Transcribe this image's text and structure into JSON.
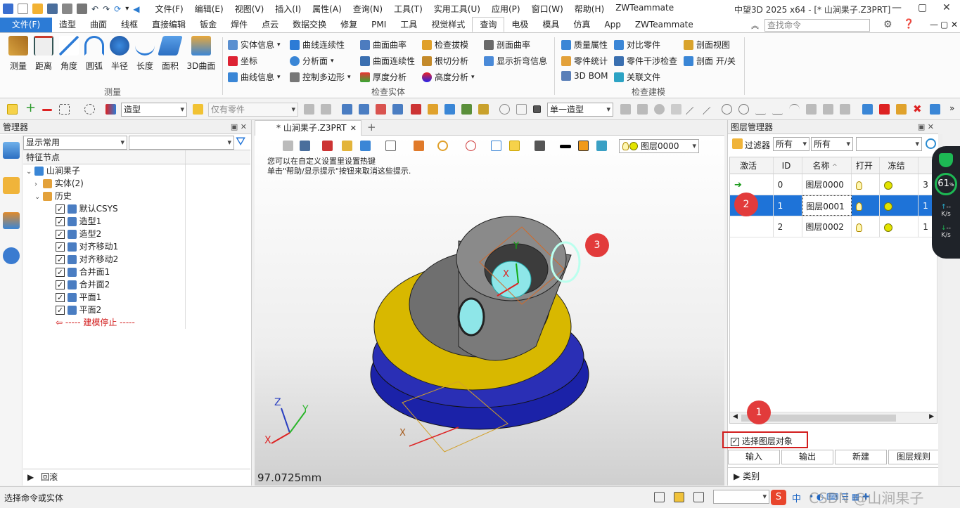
{
  "app": {
    "title": "中望3D 2025 x64 - [* 山涧果子.Z3PRT]"
  },
  "menu": [
    "文件(F)",
    "编辑(E)",
    "视图(V)",
    "插入(I)",
    "属性(A)",
    "查询(N)",
    "工具(T)",
    "实用工具(U)",
    "应用(P)",
    "窗口(W)",
    "帮助(H)",
    "ZWTeammate"
  ],
  "tabs": [
    "文件(F)",
    "造型",
    "曲面",
    "线框",
    "直接编辑",
    "钣金",
    "焊件",
    "点云",
    "数据交换",
    "修复",
    "PMI",
    "工具",
    "视觉样式",
    "查询",
    "电极",
    "模具",
    "仿真",
    "App",
    "ZWTeammate"
  ],
  "active_tab": "查询",
  "command_search": {
    "placeholder": "查找命令"
  },
  "ribbon": {
    "measure_group": "测量",
    "measure_buttons": [
      "测量",
      "距离",
      "角度",
      "圆弧",
      "半径",
      "长度",
      "面积",
      "3D曲面"
    ],
    "check_entity_group": "检查实体",
    "col1": [
      "实体信息",
      "坐标",
      "曲线信息"
    ],
    "col2": [
      "曲线连续性",
      "分析面",
      "控制多边形"
    ],
    "col3": [
      "曲面曲率",
      "曲面连续性",
      "厚度分析"
    ],
    "col4": [
      "检查拔模",
      "根切分析",
      "高度分析"
    ],
    "col5": [
      "剖面曲率",
      "显示折弯信息"
    ],
    "check_model_group": "检查建模",
    "col6": [
      "质量属性",
      "零件统计",
      "3D BOM"
    ],
    "col7": [
      "对比零件",
      "零件干涉检查",
      "关联文件"
    ],
    "col8": [
      "剖面视图",
      "剖面 开/关"
    ]
  },
  "toolbar": {
    "modeling_dd": "造型",
    "filter_dd": "仅有零件",
    "single_dd": "单一造型"
  },
  "manager": {
    "title": "管理器",
    "display_dd": "显示常用",
    "col_header": "特征节点",
    "tree": [
      {
        "label": "山涧果子",
        "level": 0,
        "check": false
      },
      {
        "label": "实体(2)",
        "level": 1,
        "check": false
      },
      {
        "label": "历史",
        "level": 1,
        "check": false
      },
      {
        "label": "默认CSYS",
        "level": 2,
        "check": true
      },
      {
        "label": "造型1",
        "level": 2,
        "check": true
      },
      {
        "label": "造型2",
        "level": 2,
        "check": true
      },
      {
        "label": "对齐移动1",
        "level": 2,
        "check": true
      },
      {
        "label": "对齐移动2",
        "level": 2,
        "check": true
      },
      {
        "label": "合并面1",
        "level": 2,
        "check": true
      },
      {
        "label": "合并面2",
        "level": 2,
        "check": true
      },
      {
        "label": "平面1",
        "level": 2,
        "check": true
      },
      {
        "label": "平面2",
        "level": 2,
        "check": true
      }
    ],
    "stop_label": "----- 建模停止 -----",
    "rollback": "回滚"
  },
  "viewport": {
    "doc_tab": "* 山涧果子.Z3PRT",
    "layer_dd": "图层0000",
    "hint1": "您可以在自定义设置里设置热键",
    "hint2": "单击\"帮助/显示提示\"按钮来取消这些提示.",
    "measure": "97.0725mm",
    "axis": {
      "x": "X",
      "y": "Y",
      "z": "Z"
    }
  },
  "layer_manager": {
    "title": "图层管理器",
    "filter_label": "过滤器",
    "filter1": "所有",
    "filter2": "所有",
    "headers": [
      "激活",
      "ID",
      "名称",
      "打开",
      "冻结"
    ],
    "rows": [
      {
        "id": "0",
        "name": "图层0000",
        "extra": "3"
      },
      {
        "id": "1",
        "name": "图层0001",
        "extra": "1"
      },
      {
        "id": "2",
        "name": "图层0002",
        "extra": "1"
      }
    ],
    "select_obj": "选择图层对象",
    "buttons": [
      "输入",
      "输出",
      "新建",
      "图层规则"
    ],
    "category": "类别"
  },
  "annotations": [
    "1",
    "2",
    "3"
  ],
  "widget": {
    "percent": "61",
    "pct_unit": "%",
    "speed": "K/s",
    "dash": "--"
  },
  "status": {
    "text": "选择命令或实体",
    "ime": "中",
    "watermark": "CSDN @山涧果子"
  },
  "colors": {
    "accent": "#2c7bd6",
    "select": "#1e73d8",
    "annot": "#e23b3b",
    "shaft": "#6f6f6f",
    "ring": "#d8b800",
    "base": "#1b22a8"
  }
}
